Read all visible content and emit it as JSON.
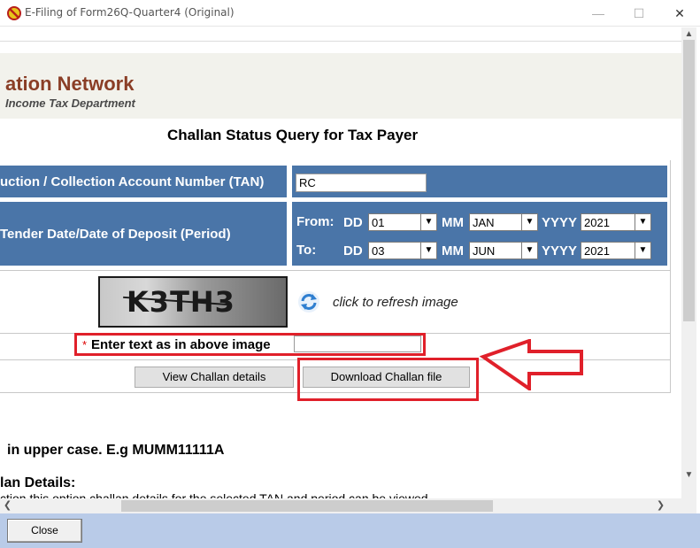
{
  "window": {
    "title": "E-Filing of Form26Q-Quarter4 (Original)",
    "minimize_glyph": "—",
    "maximize_glyph": "☐",
    "close_glyph": "✕"
  },
  "header": {
    "network_title": "ation Network",
    "department": "Income Tax Department"
  },
  "page_heading": "Challan Status Query for Tax Payer",
  "form": {
    "tan_label": "uction / Collection Account Number (TAN)",
    "tan_value": "RC",
    "period_label": "Tender Date/Date of Deposit (Period)",
    "from_label": "From:",
    "to_label": "To:",
    "dd_label": "DD",
    "mm_label": "MM",
    "yyyy_label": "YYYY",
    "from_dd": "01",
    "from_mm": "JAN",
    "from_yyyy": "2021",
    "to_dd": "03",
    "to_mm": "JUN",
    "to_yyyy": "2021",
    "captcha_text": "K3TH3",
    "refresh_text": "click to refresh image",
    "required_marker": "*",
    "captcha_input_label": "Enter text as in above image",
    "captcha_input_value": "",
    "view_button": "View Challan details",
    "download_button": "Download Challan file"
  },
  "notes": {
    "upper_case_note": "in upper case. E.g MUMM11111A",
    "challan_details_heading": "lan Details:",
    "partial_line": "ction this option challan details for the selected TAN and period can be viewed"
  },
  "footer": {
    "close_button": "Close"
  },
  "colors": {
    "blue_cell": "#4a75a8",
    "brand_red": "#8a3e26",
    "highlight_red": "#e0202a",
    "bottom_bar": "#b9cbe8"
  },
  "icons": {
    "app": "no-entry-icon",
    "refresh": "refresh-arrows-icon",
    "dropdown": "chevron-down-icon"
  }
}
